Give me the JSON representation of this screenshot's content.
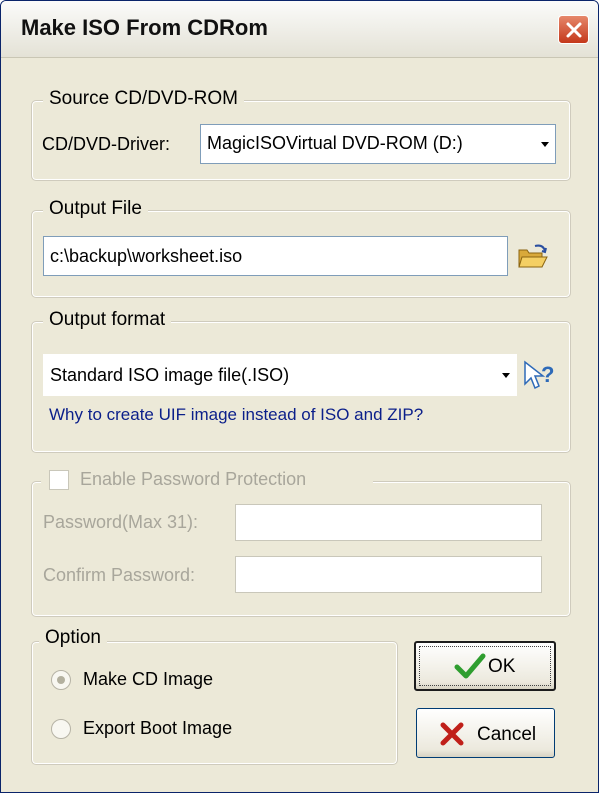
{
  "window": {
    "title": "Make ISO From CDRom"
  },
  "source": {
    "legend": "Source CD/DVD-ROM",
    "driver_label": "CD/DVD-Driver:",
    "driver_value": "MagicISOVirtual DVD-ROM  (D:)"
  },
  "output_file": {
    "legend": "Output File",
    "path": "c:\\backup\\worksheet.iso",
    "browse_icon": "folder-open-icon"
  },
  "output_format": {
    "legend": "Output format",
    "value": "Standard ISO image file(.ISO)",
    "help_icon": "cursor-help-icon",
    "link_text": "Why to create UIF image instead of ISO and ZIP?"
  },
  "password": {
    "enable_label": "Enable Password Protection",
    "enabled": false,
    "password_label": "Password(Max 31):",
    "password_value": "",
    "confirm_label": "Confirm Password:",
    "confirm_value": ""
  },
  "option": {
    "legend": "Option",
    "items": [
      {
        "label": "Make CD Image",
        "selected": true
      },
      {
        "label": "Export Boot Image",
        "selected": false
      }
    ]
  },
  "buttons": {
    "ok_label": "OK",
    "cancel_label": "Cancel"
  },
  "colors": {
    "window_bg": "#ece9d8",
    "link": "#0b1f8a",
    "ok_check": "#2f9e2f",
    "cancel_x": "#c0201a",
    "close_button": "#d9532f"
  }
}
